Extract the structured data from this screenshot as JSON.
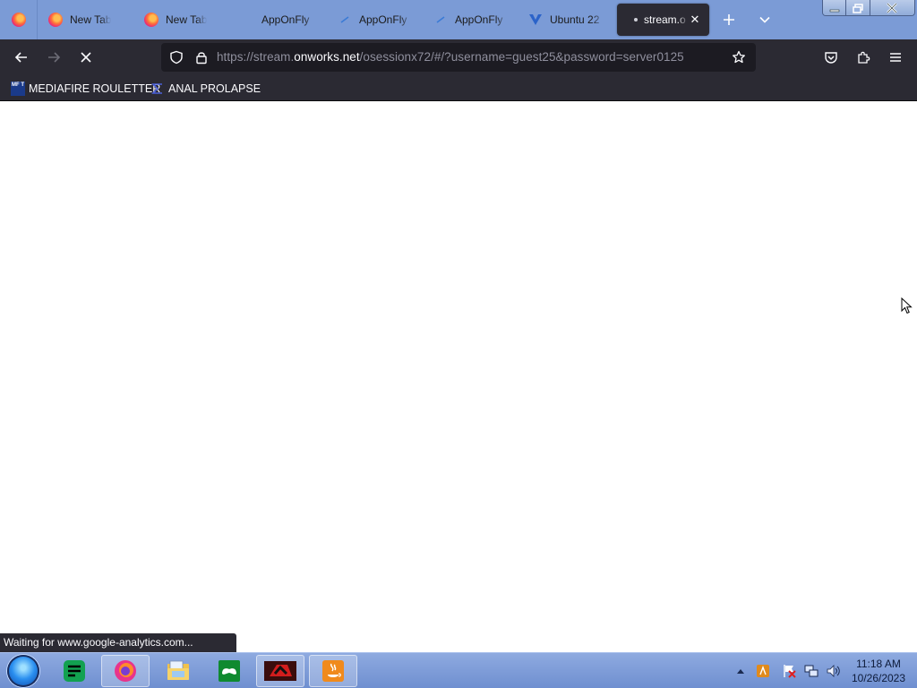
{
  "browser": {
    "tabs": [
      {
        "label": "New Tab",
        "icon": "firefox-icon",
        "active": false
      },
      {
        "label": "New Tab",
        "icon": "firefox-icon",
        "active": false
      },
      {
        "label": "AppOnFly",
        "icon": "none",
        "active": false
      },
      {
        "label": "AppOnFly",
        "icon": "apponfly-icon",
        "active": false
      },
      {
        "label": "AppOnFly",
        "icon": "apponfly-icon",
        "active": false
      },
      {
        "label": "Ubuntu 22",
        "icon": "ubuntu-v-icon",
        "active": false
      },
      {
        "label": "stream.o",
        "icon": "loading-dot-icon",
        "active": true
      }
    ],
    "url": {
      "prefix": "https://stream.",
      "host": "onworks.net",
      "suffix": "/osessionx72/#/?username=guest25&password=server0125"
    },
    "bookmarks": [
      {
        "label": "MEDIAFIRE ROULETTER",
        "icon_text": "MF T"
      },
      {
        "label": "ANAL PROLAPSE",
        "icon": "sigma-icon"
      }
    ],
    "status_text": "Waiting for www.google-analytics.com...",
    "accent_color": "#7b9bd6",
    "toolbar_color": "#2b2a33"
  },
  "taskbar": {
    "apps": [
      "planner-icon",
      "firefox-icon",
      "file-explorer-icon",
      "xbox-icon",
      "media-app-icon",
      "java-icon"
    ],
    "clock_time": "11:18 AM",
    "clock_date": "10/26/2023"
  }
}
